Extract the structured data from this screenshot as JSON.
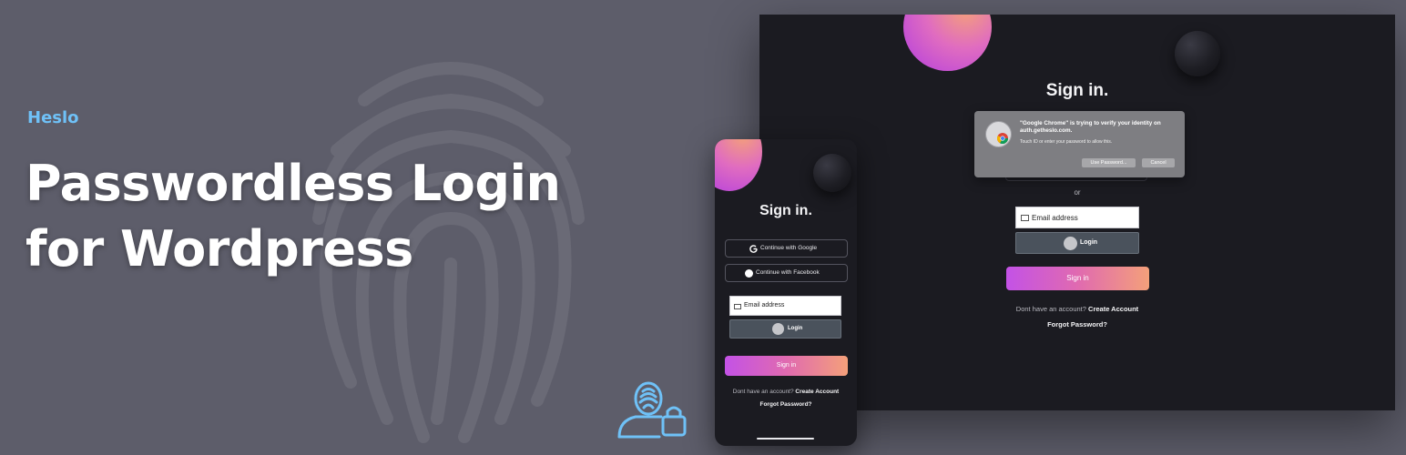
{
  "banner": {
    "brand": "Heslo",
    "headline_line1": "Passwordless Login",
    "headline_line2": "for Wordpress",
    "accent_color": "#6fc1f7"
  },
  "desktop": {
    "title": "Sign in.",
    "dialog": {
      "heading": "\"Google Chrome\" is trying to verify your identity on auth.getheslo.com.",
      "subtext": "Touch ID or enter your password to allow this.",
      "use_password_label": "Use Password...",
      "cancel_label": "Cancel"
    },
    "or_label": "or",
    "email_placeholder": "Email address",
    "login_label": "Login",
    "signin_label": "Sign in",
    "account_prompt": "Dont have an account?",
    "create_account_label": "Create Account",
    "forgot_password_label": "Forgot Password?"
  },
  "mobile": {
    "title": "Sign in.",
    "google_label": "Continue with Google",
    "facebook_label": "Continue with Facebook",
    "email_placeholder": "Email address",
    "login_label": "Login",
    "signin_label": "Sign in",
    "account_prompt": "Dont have an account?",
    "create_account_label": "Create Account",
    "forgot_password_label": "Forgot Password?"
  },
  "icons": {
    "background": "fingerprint-icon",
    "corner": "user-lock-icon",
    "google": "google-icon",
    "facebook": "facebook-icon",
    "email": "mail-icon",
    "login": "fingerprint-icon"
  }
}
